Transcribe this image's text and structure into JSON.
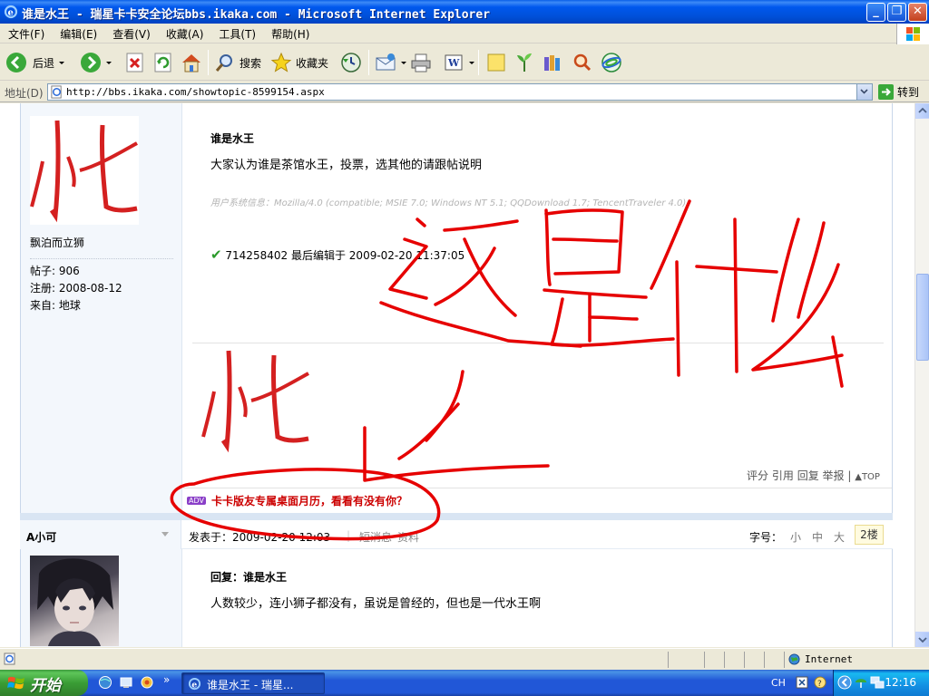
{
  "window": {
    "title": "谁是水王 - 瑞星卡卡安全论坛bbs.ikaka.com - Microsoft Internet Explorer",
    "minimize": "_",
    "maximize": "❐",
    "close": "✕"
  },
  "menu": {
    "items": [
      "文件(F)",
      "编辑(E)",
      "查看(V)",
      "收藏(A)",
      "工具(T)",
      "帮助(H)"
    ]
  },
  "toolbar": {
    "back_label": "后退",
    "search_label": "搜索",
    "favorites_label": "收藏夹"
  },
  "address": {
    "label": "地址(D)",
    "url": "http://bbs.ikaka.com/showtopic-8599154.aspx",
    "go_label": "转到"
  },
  "post1": {
    "username": "飘泊而立狮",
    "posts_label": "帖子:",
    "posts_value": "906",
    "reg_label": "注册:",
    "reg_value": "2008-08-12",
    "from_label": "来自:",
    "from_value": "地球",
    "title": "谁是水王",
    "body": "大家认为谁是茶馆水王，投票，选其他的请跟帖说明",
    "user_agent": "用户系统信息：Mozilla/4.0 (compatible; MSIE 7.0; Windows NT 5.1; QQDownload 1.7; TencentTraveler 4.0)",
    "edit_user": "714258402",
    "edit_text": "最后编辑于",
    "edit_time": "2009-02-20 11:37:05",
    "actions": [
      "评分",
      "引用",
      "回复",
      "举报",
      "|"
    ],
    "top_label": "TOP",
    "ad_badge": "ADV",
    "ad_text": "卡卡版友专属桌面月历，看看有没有你？"
  },
  "post2": {
    "username": "A小可",
    "posted_label": "发表于：",
    "posted_time": "2009-02-20 12:03",
    "sms_label": "短消息",
    "profile_label": "资料",
    "font_label": "字号：",
    "font_small": "小",
    "font_mid": "中",
    "font_large": "大",
    "floor": "2楼",
    "title": "回复：谁是水王",
    "body": "人数较少，连小狮子都没有，虽说是曾经的，但也是一代水王啊"
  },
  "status": {
    "zone": "Internet"
  },
  "taskbar": {
    "start_label": "开始",
    "task_title": "谁是水王 - 瑞星...",
    "lang": "CH",
    "clock": "12:16"
  },
  "colors": {
    "ink_red": "#e60000",
    "accent_blue": "#0054e3",
    "ad_red": "#cc0000"
  }
}
